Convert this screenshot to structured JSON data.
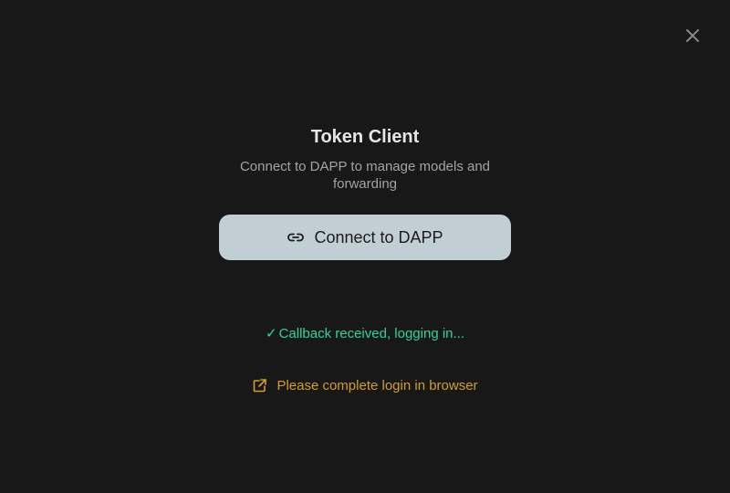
{
  "window": {
    "close_icon": "close-icon"
  },
  "header": {
    "title": "Token Client",
    "subtitle": "Connect to DAPP to manage models and forwarding"
  },
  "connect_button": {
    "label": "Connect to DAPP",
    "icon": "link-icon"
  },
  "status": {
    "check_glyph": "✓",
    "text": "Callback received, logging in..."
  },
  "login_hint": {
    "icon": "external-link-icon",
    "text": "Please complete login in browser"
  },
  "colors": {
    "background": "#181818",
    "button_bg": "#c1cfd4",
    "success": "#34d399",
    "warning": "#d39e2c"
  }
}
